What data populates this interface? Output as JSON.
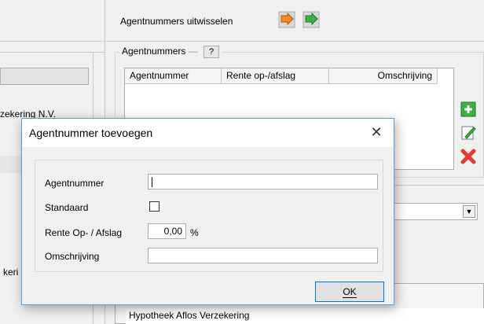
{
  "top": {
    "exchange_label": "Agentnummers uitwisselen"
  },
  "agent_group": {
    "legend": "Agentnummers",
    "help_label": "?",
    "columns": [
      "Agentnummer",
      "Rente op-/afslag",
      "Omschrijving"
    ]
  },
  "left_panel": {
    "text_1": "zekering N.V.",
    "text_2": "keri"
  },
  "bottom": {
    "row_text": "Hypotheek Aflos Verzekering"
  },
  "dialog": {
    "title": "Agentnummer toevoegen",
    "close_glyph": "✕",
    "agentnummer_label": "Agentnummer",
    "agentnummer_value": "",
    "standaard_label": "Standaard",
    "standaard_checked": false,
    "rente_label": "Rente Op- / Afslag",
    "rente_value": "0,00",
    "rente_unit": "%",
    "omschrijving_label": "Omschrijving",
    "omschrijving_value": "",
    "ok_label": "OK"
  },
  "colors": {
    "dialog_border": "#5a9fd6",
    "ok_border": "#0078d7",
    "add_green": "#3cb043",
    "delete_red": "#e53935",
    "export_orange": "#f08a24"
  }
}
